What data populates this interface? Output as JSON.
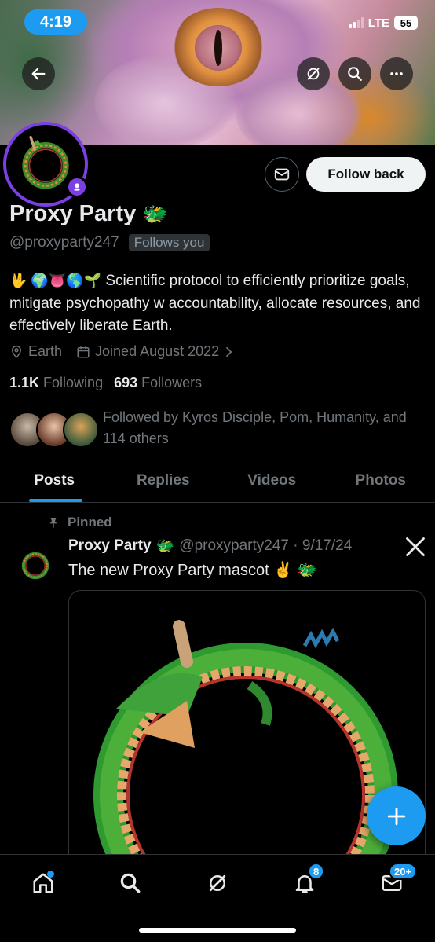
{
  "status_bar": {
    "time": "4:19",
    "network": "LTE",
    "battery": "55"
  },
  "profile": {
    "name": "Proxy Party",
    "name_emoji": "🐲",
    "handle": "@proxyparty247",
    "follows_you_label": "Follows you",
    "follow_button": "Follow back",
    "bio_emojis": "🖖 🌍👅🌎🌱",
    "bio_text": "Scientific protocol to efficiently prioritize goals, mitigate psychopathy w accountability, allocate resources, and effectively liberate Earth.",
    "location": "Earth",
    "joined": "Joined August 2022",
    "following_count": "1.1K",
    "following_label": "Following",
    "followers_count": "693",
    "followers_label": "Followers",
    "followed_by": "Followed by Kyros Disciple, Pom, Humanity, and 114 others"
  },
  "tabs": [
    "Posts",
    "Replies",
    "Videos",
    "Photos"
  ],
  "active_tab": "Posts",
  "pinned_post": {
    "pinned_label": "Pinned",
    "author": "Proxy Party",
    "author_emoji": "🐲",
    "handle_date": "@proxyparty247 · 9/17/24",
    "text": "The new Proxy Party mascot ✌️ 🐲"
  },
  "bottom_nav": {
    "notifications_badge": "8",
    "messages_badge": "20+"
  },
  "colors": {
    "accent": "#1d9bf0",
    "avatar_ring": "#7b3fe4",
    "background": "#000000"
  },
  "icons": [
    "back-arrow-icon",
    "grok-icon",
    "search-icon",
    "more-icon",
    "message-icon",
    "location-icon",
    "calendar-icon",
    "pin-icon",
    "x-logo-icon",
    "compose-plus-icon",
    "home-icon",
    "bell-icon",
    "mail-icon"
  ]
}
